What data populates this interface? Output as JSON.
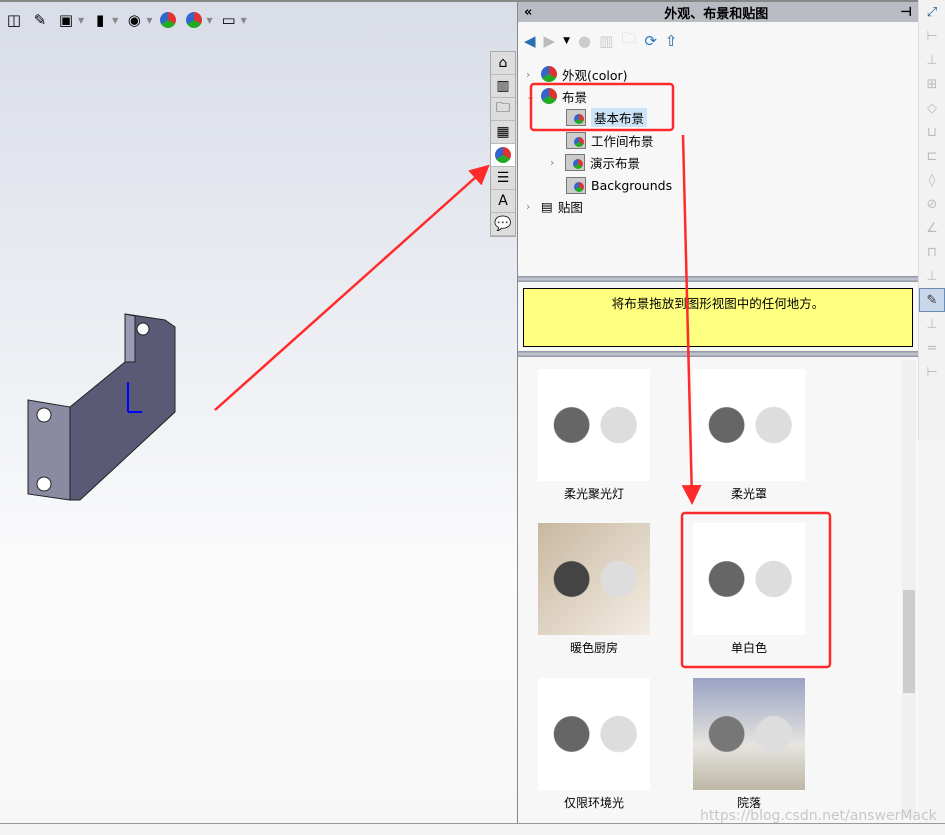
{
  "viewport": {
    "toolbar": [
      "section-view-icon",
      "annotation-icon",
      "view-orientation-icon",
      "display-style-icon",
      "hide-show-icon",
      "edit-appearance-icon",
      "apply-scene-icon",
      "view-settings-icon"
    ],
    "side_tabs": [
      "home-icon",
      "parts-library-icon",
      "file-explorer-icon",
      "view-palette-icon",
      "appearances-icon",
      "custom-properties-icon",
      "design-library-icon",
      "forum-icon"
    ]
  },
  "panel": {
    "title": "外观、布景和贴图",
    "tree": [
      {
        "label": "外观(color)"
      },
      {
        "label": "布景"
      },
      {
        "label": "基本布景"
      },
      {
        "label": "工作间布景"
      },
      {
        "label": "演示布景"
      },
      {
        "label": "Backgrounds"
      },
      {
        "label": "贴图"
      }
    ],
    "hint": "将布景拖放到图形视图中的任何地方。",
    "gallery": [
      {
        "label": "柔光聚光灯"
      },
      {
        "label": "柔光罩"
      },
      {
        "label": "暖色厨房"
      },
      {
        "label": "单白色"
      },
      {
        "label": "仅限环境光"
      },
      {
        "label": "院落"
      }
    ]
  },
  "watermark": "https://blog.csdn.net/answerMack",
  "annotation_color": "#ff2a2a"
}
